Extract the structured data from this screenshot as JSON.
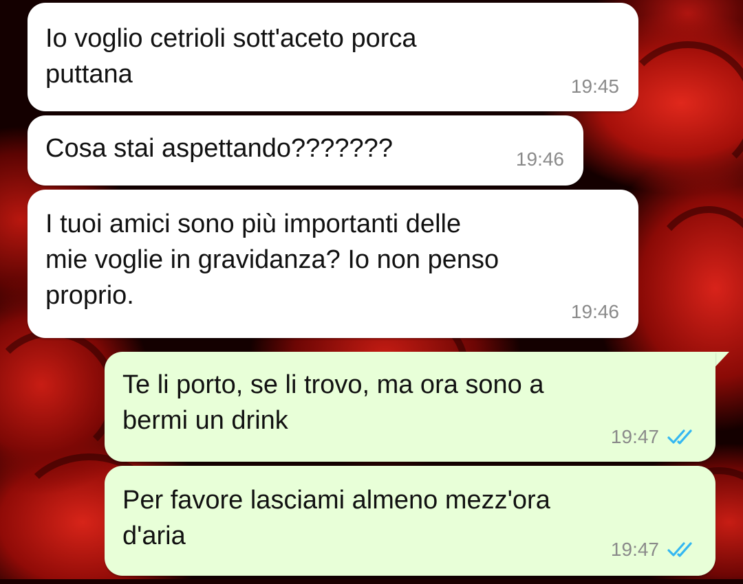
{
  "messages": [
    {
      "direction": "incoming",
      "text": "Io voglio cetrioli sott'aceto porca\nputtana",
      "time": "19:45"
    },
    {
      "direction": "incoming",
      "text": "Cosa stai aspettando???????",
      "time": "19:46"
    },
    {
      "direction": "incoming",
      "text": "I tuoi amici sono più importanti delle\nmie voglie in gravidanza? Io non penso\nproprio.",
      "time": "19:46"
    },
    {
      "direction": "outgoing",
      "text": "Te li porto, se li trovo, ma ora sono a\nbermi un drink",
      "time": "19:47",
      "status": "read"
    },
    {
      "direction": "outgoing",
      "text": "Per favore lasciami almeno mezz'ora\nd'aria",
      "time": "19:47",
      "status": "read"
    }
  ],
  "colors": {
    "incoming_bubble": "#ffffff",
    "outgoing_bubble": "#e8ffd8",
    "read_ticks": "#34b7f1",
    "timestamp": "#8a8a8a"
  },
  "icons": {
    "read_status": "double-check-icon",
    "wallpaper": "red-roses-wallpaper"
  }
}
